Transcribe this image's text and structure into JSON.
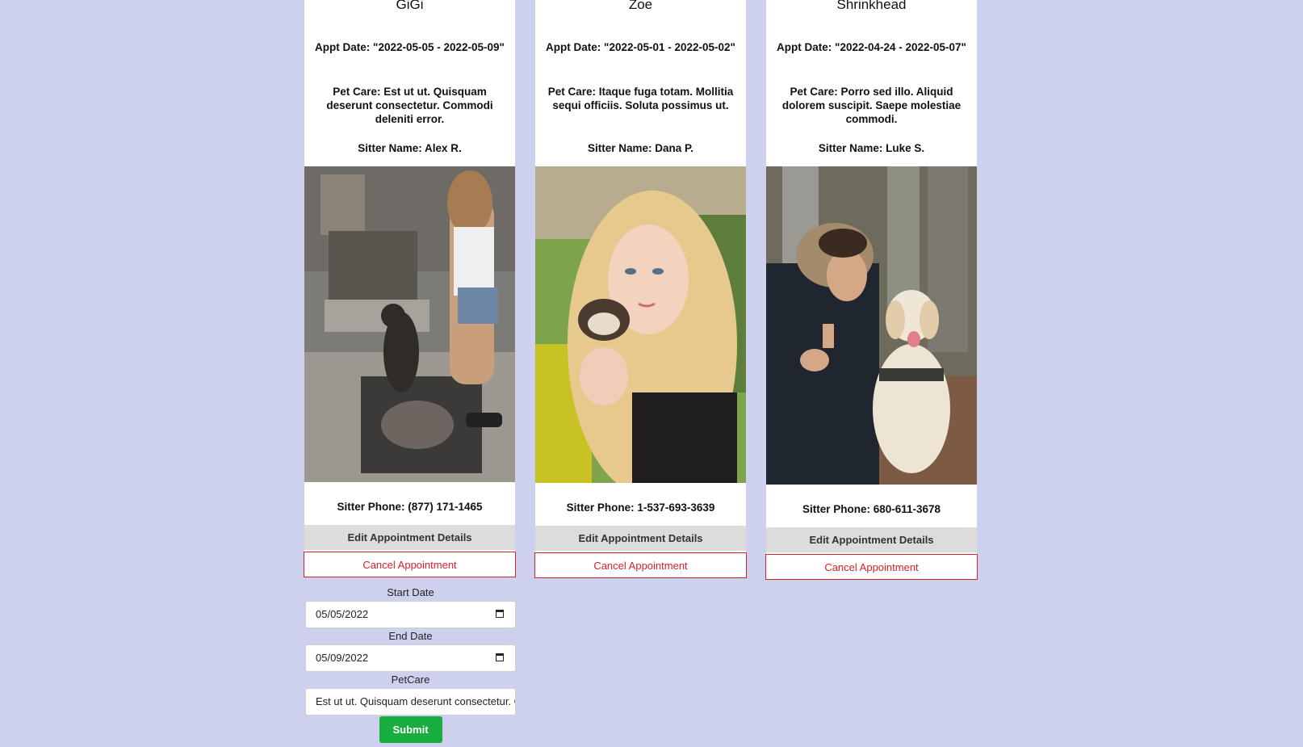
{
  "cards": [
    {
      "pet_name": "GiGi",
      "appt_date": "Appt Date: \"2022-05-05 - 2022-05-09\"",
      "pet_care": "Pet Care: Est ut ut. Quisquam deserunt consectetur. Commodi deleniti error.",
      "sitter_name": "Sitter Name: Alex R.",
      "photo_icon": "sitter-photo-woman-with-dog",
      "sitter_phone": "Sitter Phone: (877) 171-1465",
      "edit_label": "Edit Appointment Details",
      "cancel_label": "Cancel Appointment"
    },
    {
      "pet_name": "Zoe",
      "appt_date": "Appt Date: \"2022-05-01 - 2022-05-02\"",
      "pet_care": "Pet Care: Itaque fuga totam. Mollitia sequi officiis. Soluta possimus ut.",
      "sitter_name": "Sitter Name: Dana P.",
      "photo_icon": "sitter-photo-woman-with-ferret",
      "sitter_phone": "Sitter Phone: 1-537-693-3639",
      "edit_label": "Edit Appointment Details",
      "cancel_label": "Cancel Appointment"
    },
    {
      "pet_name": "Shrinkhead",
      "appt_date": "Appt Date: \"2022-04-24 - 2022-05-07\"",
      "pet_care": "Pet Care: Porro sed illo. Aliquid dolorem suscipit. Saepe molestiae commodi.",
      "sitter_name": "Sitter Name: Luke S.",
      "photo_icon": "sitter-photo-man-with-dog",
      "sitter_phone": "Sitter Phone: 680-611-3678",
      "edit_label": "Edit Appointment Details",
      "cancel_label": "Cancel Appointment"
    }
  ],
  "edit_form": {
    "start_label": "Start Date",
    "start_value": "05/05/2022",
    "end_label": "End Date",
    "end_value": "05/09/2022",
    "petcare_label": "PetCare",
    "petcare_value": "Est ut ut. Quisquam deserunt consectetur. Commodi deleniti error.",
    "submit_label": "Submit"
  },
  "colors": {
    "background": "#ced1ee",
    "cancel_red": "#d6202a",
    "submit_green": "#18ad3e",
    "edit_gray": "#dcdcdc"
  }
}
